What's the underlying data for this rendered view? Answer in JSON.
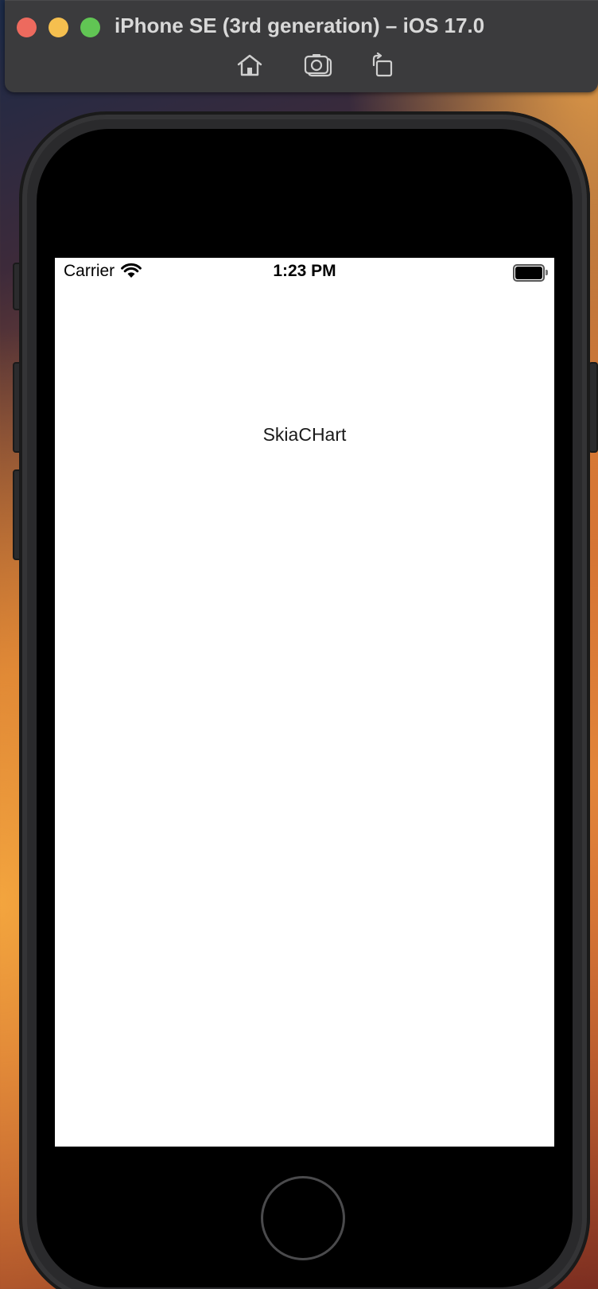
{
  "window": {
    "title": "iPhone SE (3rd generation) – iOS 17.0",
    "toolbar": {
      "home_icon": "home-icon",
      "screenshot_icon": "camera-icon",
      "rotate_icon": "rotate-icon"
    }
  },
  "status_bar": {
    "carrier": "Carrier",
    "time": "1:23 PM",
    "wifi_icon": "wifi-icon",
    "battery_icon": "battery-icon"
  },
  "app": {
    "label": "SkiaCHart"
  },
  "colors": {
    "close": "#ed6a5e",
    "minimize": "#f5bf4f",
    "zoom": "#61c554",
    "screen_background": "#ffffff"
  }
}
